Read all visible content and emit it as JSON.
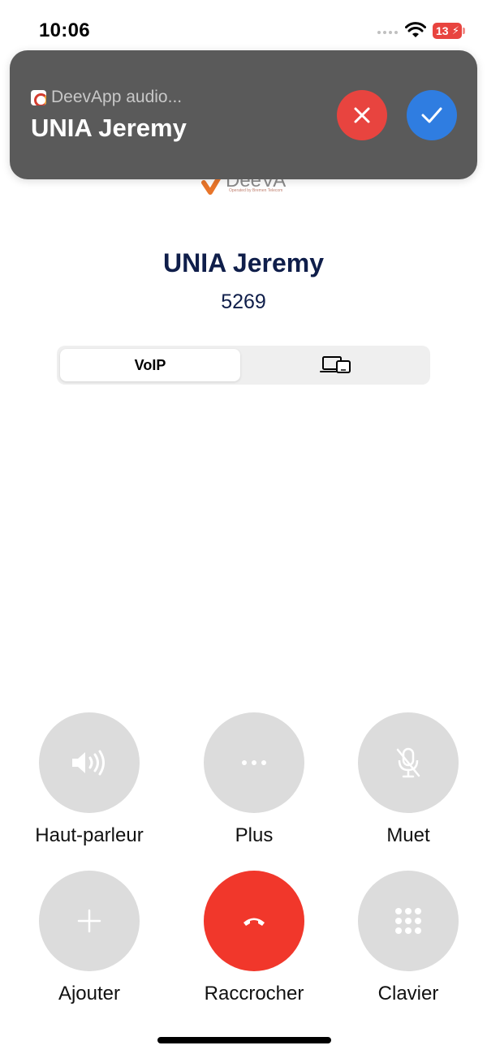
{
  "status_bar": {
    "time": "10:06",
    "battery": "13"
  },
  "logo": {
    "text": "DeeVA",
    "tagline": "Operated by Bremen Telecom"
  },
  "banner": {
    "app_name": "DeevApp audio...",
    "caller": "UNIA Jeremy",
    "decline_icon": "close-icon",
    "accept_icon": "check-icon",
    "colors": {
      "decline": "#e8443f",
      "accept": "#2f7de1"
    }
  },
  "call": {
    "name": "UNIA Jeremy",
    "number": "5269"
  },
  "segment": {
    "voip_label": "VoIP",
    "devices_icon": "devices-icon"
  },
  "actions": [
    {
      "label": "Haut-parleur",
      "icon": "speaker-icon"
    },
    {
      "label": "Plus",
      "icon": "more-icon"
    },
    {
      "label": "Muet",
      "icon": "mic-off-icon"
    },
    {
      "label": "Ajouter",
      "icon": "add-icon"
    },
    {
      "label": "Raccrocher",
      "icon": "hangup-icon"
    },
    {
      "label": "Clavier",
      "icon": "keypad-icon"
    }
  ],
  "colors": {
    "hangup": "#f1372b",
    "caller_text": "#0f1e4a",
    "action_bg": "#dcdcdc"
  }
}
